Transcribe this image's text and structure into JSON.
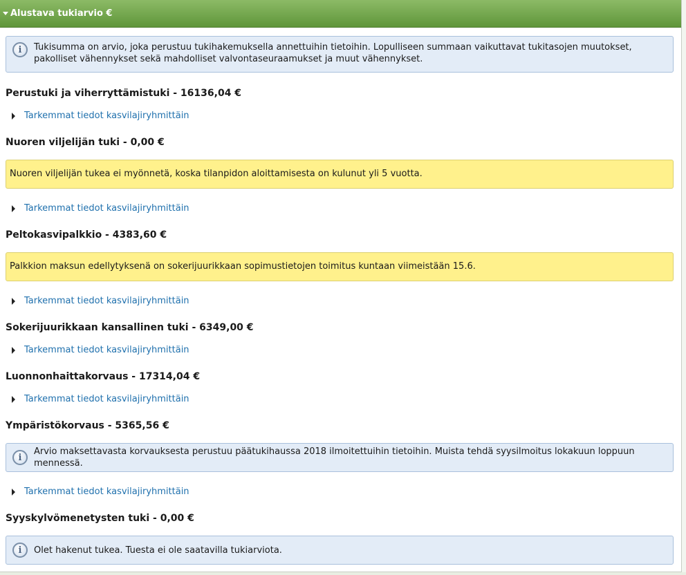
{
  "panel": {
    "title": "Alustava tukiarvio €"
  },
  "intro_info": "Tukisumma on arvio, joka perustuu tukihakemuksella annettuihin tietoihin. Lopulliseen summaan vaikuttavat tukitasojen muutokset, pakolliset vähennykset sekä mahdolliset valvontaseuraamukset ja muut vähennykset.",
  "details_label": "Tarkemmat tiedot kasvilajiryhmittäin",
  "sections": [
    {
      "title": "Perustuki ja viherryttämistuki - 16136,04 €"
    },
    {
      "title": "Nuoren viljelijän tuki - 0,00 €",
      "warning": "Nuoren viljelijän tukea ei myönnetä, koska tilanpidon aloittamisesta on kulunut yli 5 vuotta."
    },
    {
      "title": "Peltokasvipalkkio - 4383,60 €",
      "warning": "Palkkion maksun edellytyksenä on sokerijuurikkaan sopimustietojen toimitus kuntaan viimeistään 15.6."
    },
    {
      "title": "Sokerijuurikkaan kansallinen tuki - 6349,00 €"
    },
    {
      "title": "Luonnonhaittakorvaus - 17314,04 €"
    },
    {
      "title": "Ympäristökorvaus - 5365,56 €",
      "info": "Arvio maksettavasta korvauksesta perustuu päätukihaussa 2018 ilmoitettuihin tietoihin. Muista tehdä syysilmoitus lokakuun loppuun mennessä."
    },
    {
      "title": "Syyskylvömenetysten tuki - 0,00 €",
      "info": "Olet hakenut tukea. Tuesta ei ole saatavilla tukiarviota."
    }
  ],
  "icons": {
    "info": "info-icon",
    "collapse": "caret-down-icon",
    "expand": "caret-right-icon"
  },
  "colors": {
    "header_green": "#6fa548",
    "info_bg": "#e3ecf7",
    "warning_bg": "#fff18c",
    "link": "#1f70ad"
  }
}
